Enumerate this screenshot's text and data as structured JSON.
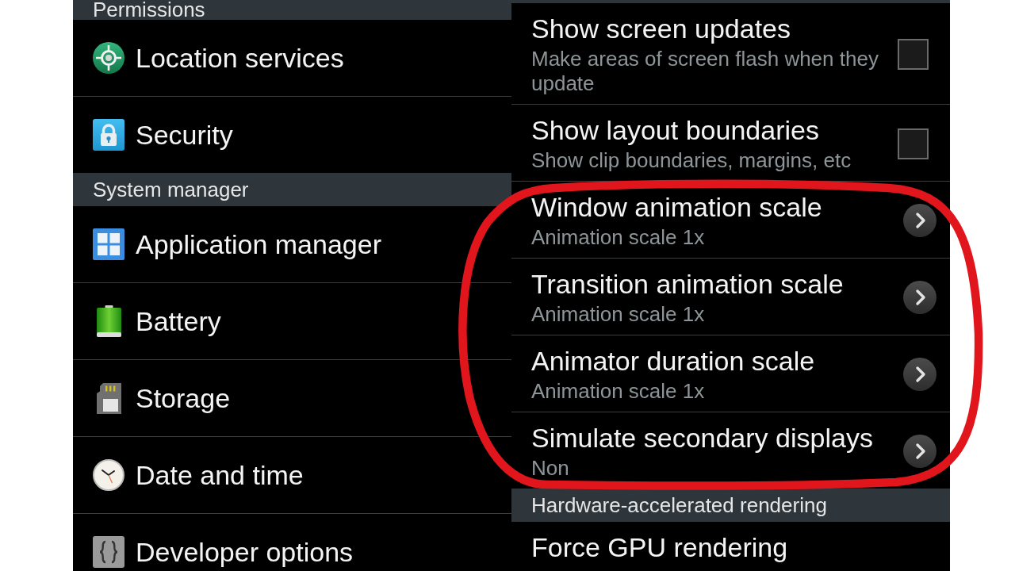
{
  "left_screen": {
    "sections": [
      {
        "header": "Permissions",
        "items": [
          {
            "label": "Location services"
          },
          {
            "label": "Security"
          }
        ]
      },
      {
        "header": "System manager",
        "items": [
          {
            "label": "Application manager"
          },
          {
            "label": "Battery"
          },
          {
            "label": "Storage"
          },
          {
            "label": "Date and time"
          },
          {
            "label": "Developer options"
          }
        ]
      }
    ]
  },
  "right_screen": {
    "sections": [
      {
        "items": [
          {
            "kind": "checkbox",
            "title": "Show screen updates",
            "summary": "Make areas of screen flash when they update",
            "checked": false
          },
          {
            "kind": "checkbox",
            "title": "Show layout boundaries",
            "summary": "Show clip boundaries, margins, etc",
            "checked": false
          },
          {
            "kind": "link",
            "title": "Window animation scale",
            "summary": "Animation scale 1x"
          },
          {
            "kind": "link",
            "title": "Transition animation scale",
            "summary": "Animation scale 1x"
          },
          {
            "kind": "link",
            "title": "Animator duration scale",
            "summary": "Animation scale 1x"
          },
          {
            "kind": "link",
            "title": "Simulate secondary displays",
            "summary": "Non"
          }
        ]
      },
      {
        "header": "Hardware-accelerated rendering",
        "items": [
          {
            "kind": "plain",
            "title": "Force GPU rendering"
          }
        ]
      }
    ]
  }
}
